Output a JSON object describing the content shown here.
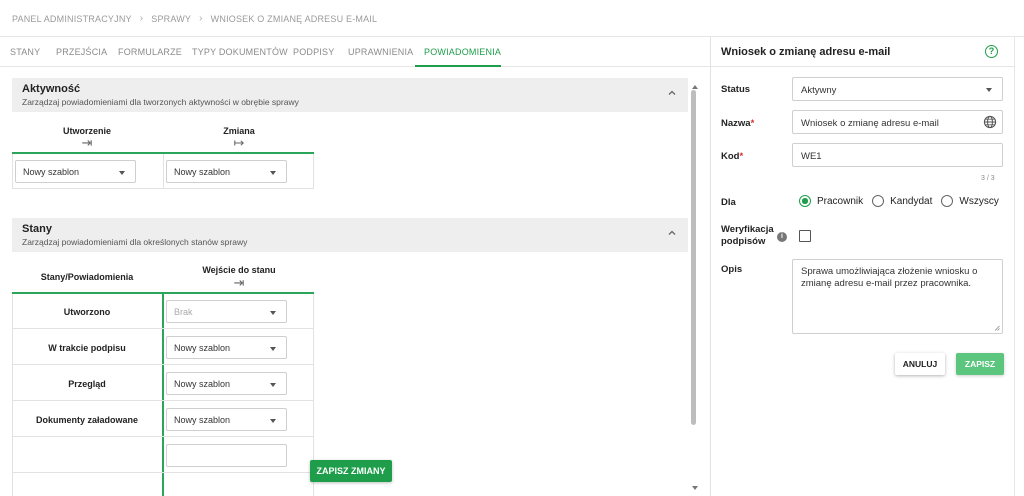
{
  "breadcrumb": {
    "items": [
      "PANEL ADMINISTRACYJNY",
      "SPRAWY",
      "WNIOSEK O ZMIANĘ ADRESU E-MAIL"
    ]
  },
  "tabs": [
    {
      "label": "STANY",
      "active": false
    },
    {
      "label": "PRZEJŚCIA",
      "active": false
    },
    {
      "label": "FORMULARZE",
      "active": false
    },
    {
      "label": "TYPY DOKUMENTÓW",
      "active": false
    },
    {
      "label": "PODPISY",
      "active": false
    },
    {
      "label": "UPRAWNIENIA",
      "active": false
    },
    {
      "label": "POWIADOMIENIA",
      "active": true
    }
  ],
  "activity_section": {
    "title": "Aktywność",
    "subtitle": "Zarządzaj powiadomieniami dla tworzonych aktywności w obrębie sprawy",
    "columns": [
      {
        "label": "Utworzenie",
        "icon": "arrow-to-right-bar-icon",
        "value": "Nowy szablon"
      },
      {
        "label": "Zmiana",
        "icon": "arrow-from-bar-right-icon",
        "value": "Nowy szablon"
      }
    ]
  },
  "states_section": {
    "title": "Stany",
    "subtitle": "Zarządzaj powiadomieniami dla określonych stanów sprawy",
    "col_state": "Stany/Powiadomienia",
    "col_enter": "Wejście do stanu",
    "rows": [
      {
        "label": "Utworzono",
        "value": "Brak",
        "disabled": true
      },
      {
        "label": "W trakcie podpisu",
        "value": "Nowy szablon",
        "disabled": false
      },
      {
        "label": "Przegląd",
        "value": "Nowy szablon",
        "disabled": false
      },
      {
        "label": "Dokumenty załadowane",
        "value": "Nowy szablon",
        "disabled": false
      }
    ]
  },
  "save_changes_label": "ZAPISZ ZMIANY",
  "panel": {
    "title": "Wniosek o zmianę adresu e-mail",
    "status_label": "Status",
    "status_value": "Aktywny",
    "name_label": "Nazwa",
    "name_value": "Wniosek o zmianę adresu e-mail",
    "code_label": "Kod",
    "code_value": "WE1",
    "code_counter": "3 / 3",
    "for_label": "Dla",
    "for_options": [
      {
        "label": "Pracownik",
        "checked": true
      },
      {
        "label": "Kandydat",
        "checked": false
      },
      {
        "label": "Wszyscy",
        "checked": false
      }
    ],
    "verify_label_1": "Weryfikacja",
    "verify_label_2": "podpisów",
    "verify_checked": false,
    "desc_label": "Opis",
    "desc_value": "Sprawa umożliwiająca złożenie wniosku o zmianę adresu e-mail przez pracownika.",
    "cancel_label": "ANULUJ",
    "save_label": "ZAPISZ"
  },
  "colors": {
    "accent": "#1e9e4a",
    "save_disabled": "#5cc57e",
    "required": "#d32f2f"
  }
}
